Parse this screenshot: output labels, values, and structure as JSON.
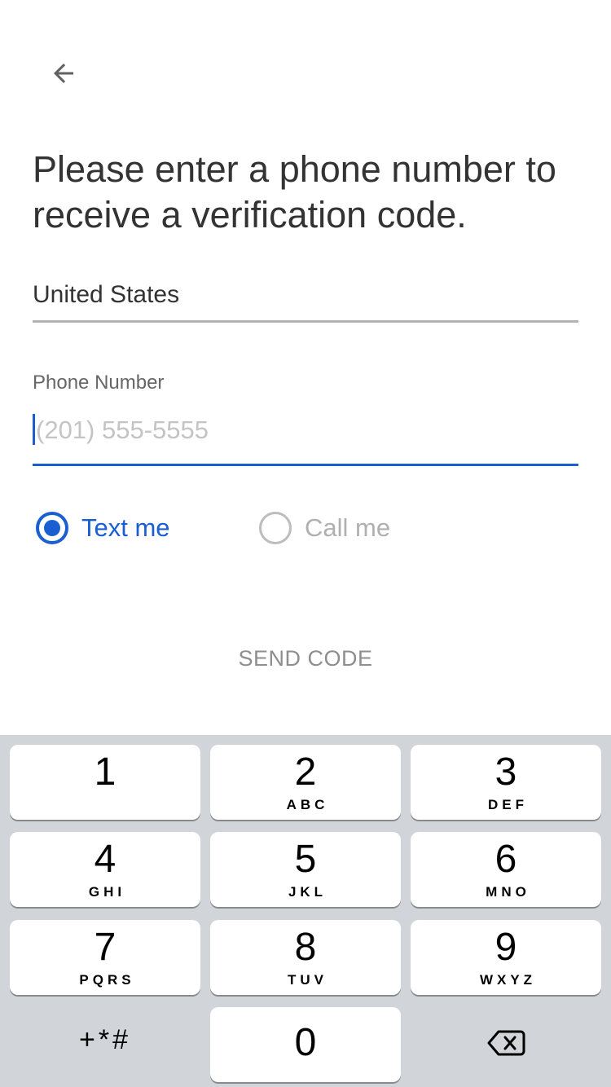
{
  "header": {
    "back_icon": "arrow-left-icon",
    "title": "Please enter a phone number to receive a verification code."
  },
  "country": {
    "value": "United States"
  },
  "phone": {
    "label": "Phone Number",
    "placeholder": "(201) 555-5555",
    "value": ""
  },
  "delivery": {
    "options": [
      {
        "label": "Text me",
        "selected": true
      },
      {
        "label": "Call me",
        "selected": false
      }
    ]
  },
  "actions": {
    "send_label": "SEND CODE"
  },
  "keypad": {
    "keys": [
      {
        "digit": "1",
        "letters": ""
      },
      {
        "digit": "2",
        "letters": "ABC"
      },
      {
        "digit": "3",
        "letters": "DEF"
      },
      {
        "digit": "4",
        "letters": "GHI"
      },
      {
        "digit": "5",
        "letters": "JKL"
      },
      {
        "digit": "6",
        "letters": "MNO"
      },
      {
        "digit": "7",
        "letters": "PQRS"
      },
      {
        "digit": "8",
        "letters": "TUV"
      },
      {
        "digit": "9",
        "letters": "WXYZ"
      },
      {
        "digit": "0",
        "letters": ""
      }
    ],
    "symbols_label": "+*#",
    "delete_icon": "backspace-icon"
  },
  "colors": {
    "accent": "#1a5fd1",
    "text": "#333333",
    "keypad_bg": "#d1d4d9"
  }
}
